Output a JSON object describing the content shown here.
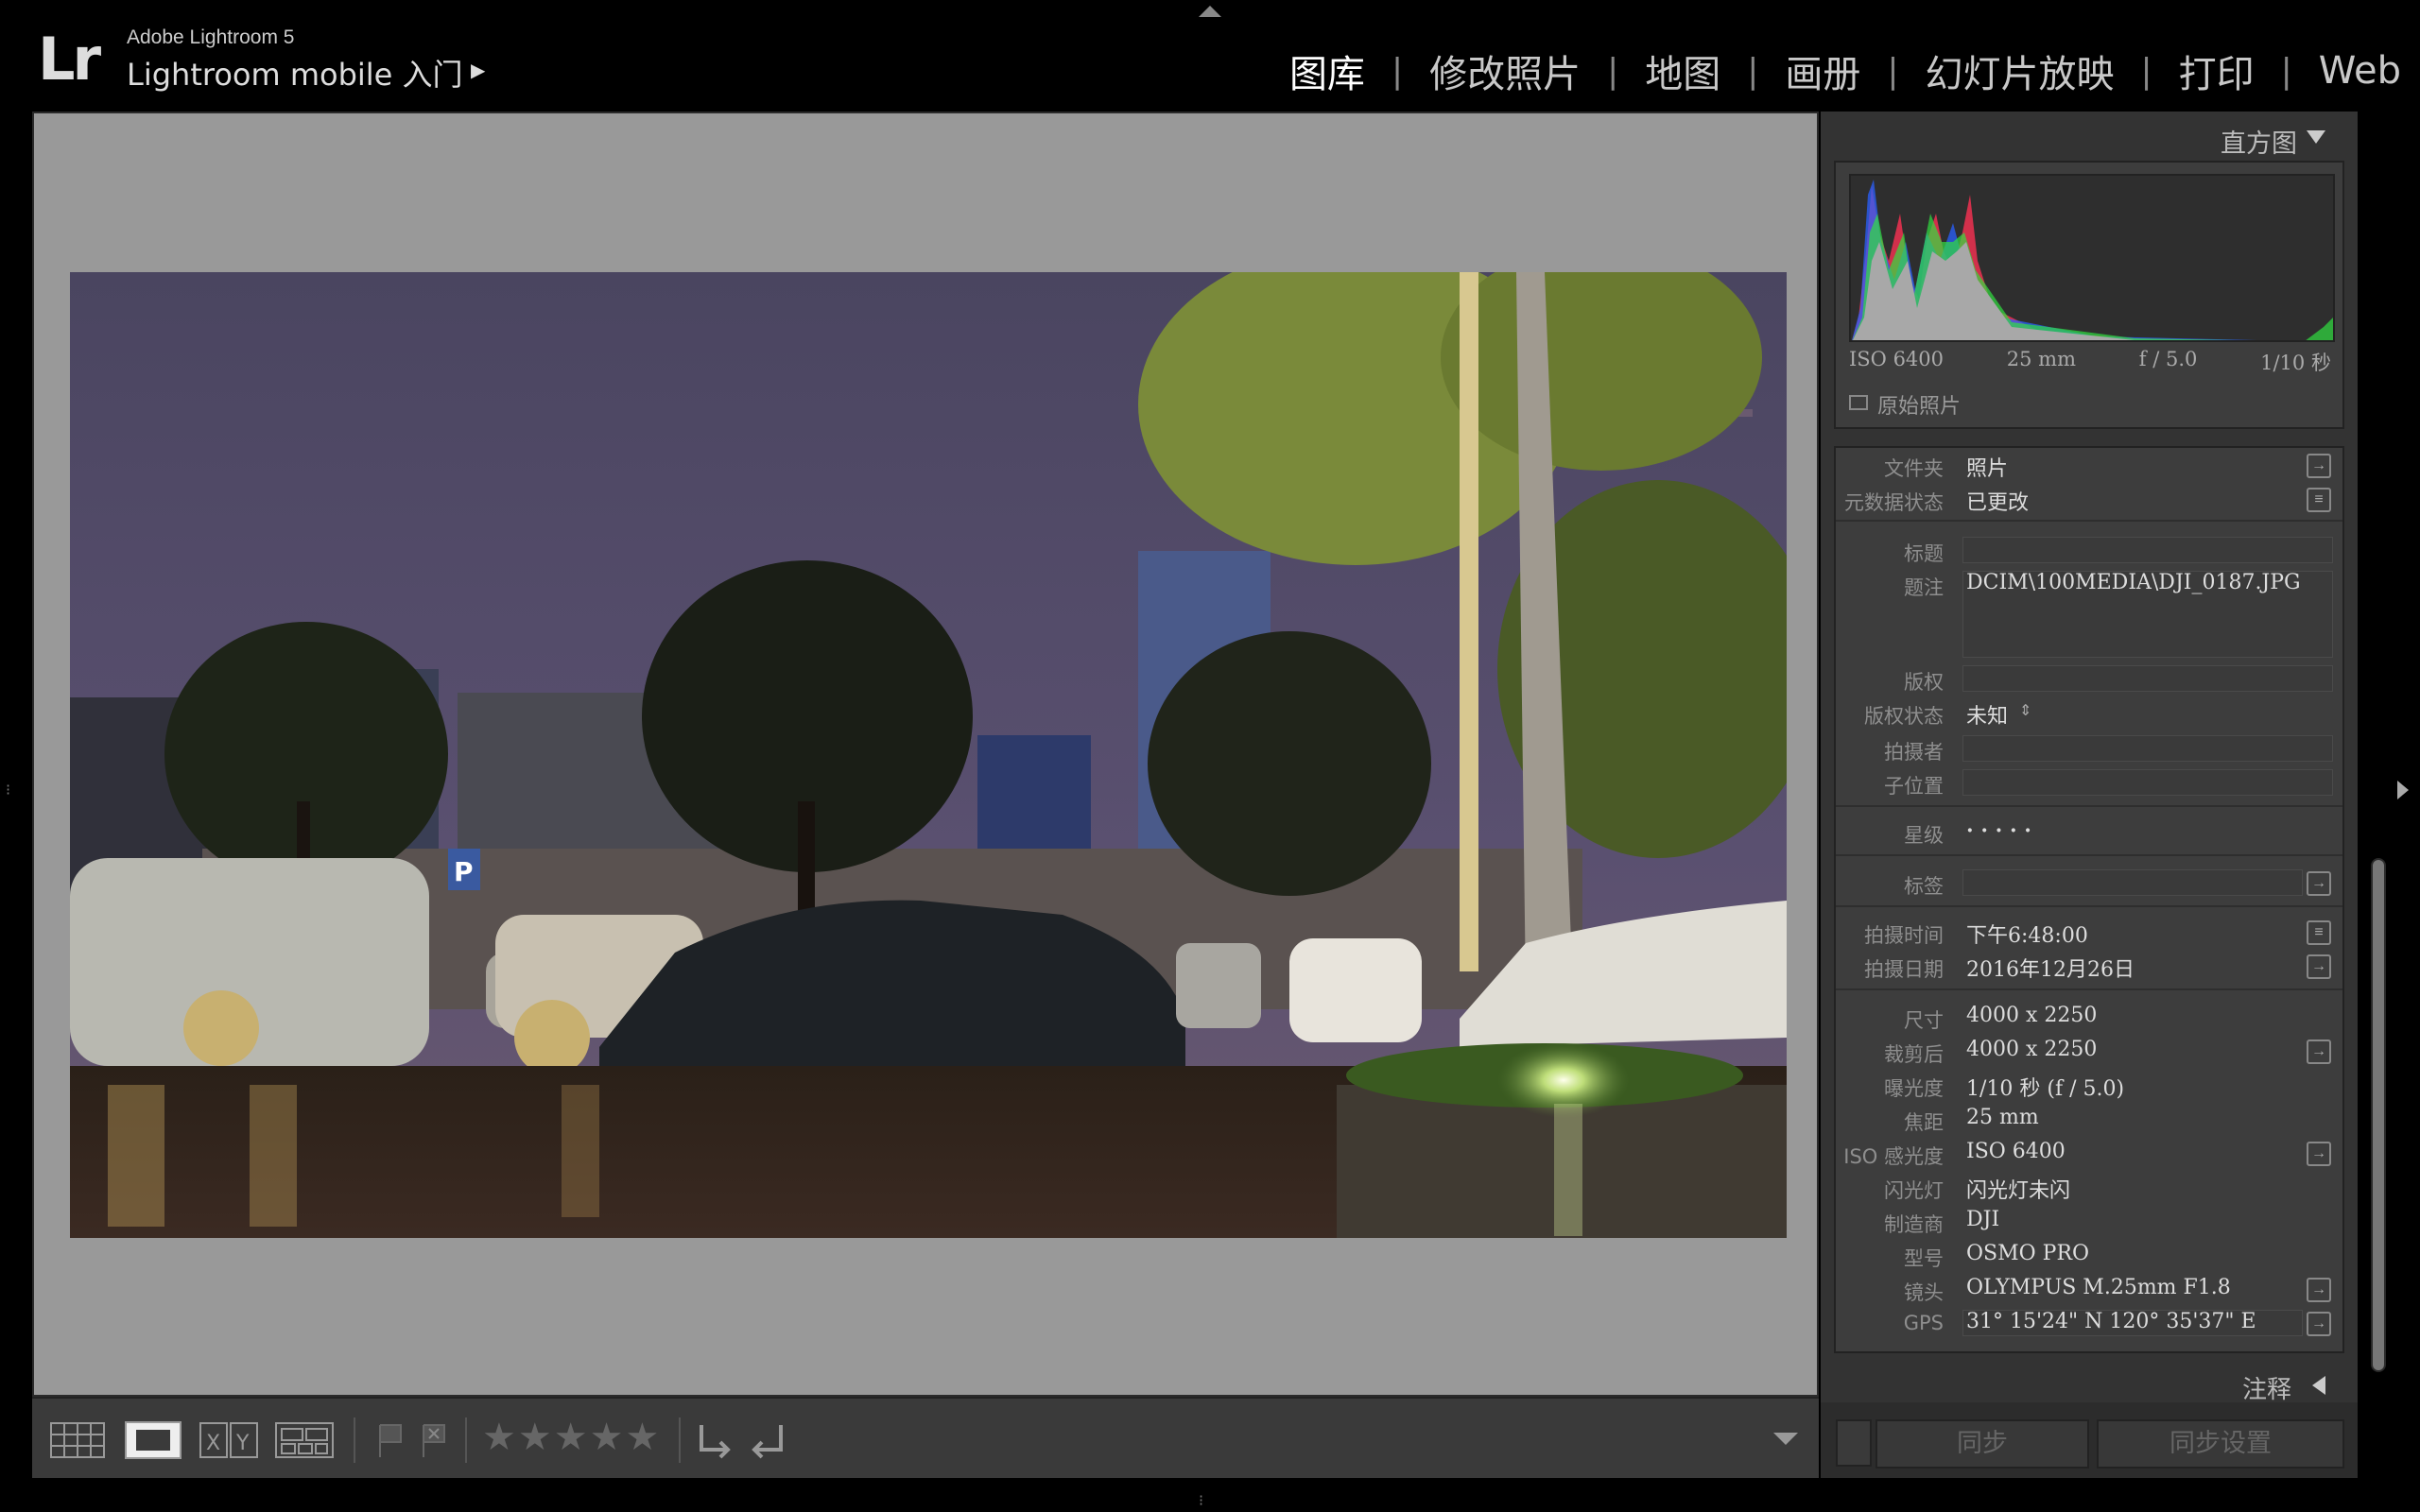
{
  "app": {
    "logo": "Lr",
    "name": "Adobe Lightroom 5",
    "catalog": "Lightroom mobile 入门",
    "catalog_arrow": "▶"
  },
  "modules": [
    {
      "label": "图库",
      "active": true
    },
    {
      "label": "修改照片",
      "active": false
    },
    {
      "label": "地图",
      "active": false
    },
    {
      "label": "画册",
      "active": false
    },
    {
      "label": "幻灯片放映",
      "active": false
    },
    {
      "label": "打印",
      "active": false
    },
    {
      "label": "Web",
      "active": false
    }
  ],
  "histogram": {
    "title": "直方图",
    "iso": "ISO 6400",
    "focal": "25 mm",
    "aperture": "f / 5.0",
    "shutter": "1/10 秒",
    "original_label": "原始照片"
  },
  "metadata": {
    "folder_label": "文件夹",
    "folder_value": "照片",
    "status_label": "元数据状态",
    "status_value": "已更改",
    "title_label": "标题",
    "caption_label": "题注",
    "caption_value": "DCIM\\100MEDIA\\DJI_0187.JPG",
    "copyright_label": "版权",
    "copyright_status_label": "版权状态",
    "copyright_status_value": "未知",
    "creator_label": "拍摄者",
    "sublocation_label": "子位置",
    "rating_label": "星级",
    "rating_value": "·  ·  ·  ·  ·",
    "label_label": "标签",
    "capture_time_label": "拍摄时间",
    "capture_time_value": "下午6:48:00",
    "capture_date_label": "拍摄日期",
    "capture_date_value": "2016年12月26日",
    "dimensions_label": "尺寸",
    "dimensions_value": "4000 x 2250",
    "cropped_label": "裁剪后",
    "cropped_value": "4000 x 2250",
    "exposure_label": "曝光度",
    "exposure_value": "1/10 秒 (f / 5.0)",
    "focal_label": "焦距",
    "focal_value": "25 mm",
    "iso_label": "ISO 感光度",
    "iso_value": "ISO 6400",
    "flash_label": "闪光灯",
    "flash_value": "闪光灯未闪",
    "make_label": "制造商",
    "make_value": "DJI",
    "model_label": "型号",
    "model_value": "OSMO PRO",
    "lens_label": "镜头",
    "lens_value": "OLYMPUS M.25mm F1.8",
    "gps_label": "GPS",
    "gps_value": "31° 15'24\" N 120° 35'37\" E"
  },
  "annotations": {
    "title": "注释"
  },
  "sync": {
    "sync_label": "同步",
    "sync_settings_label": "同步设置"
  },
  "toolbar": {
    "stars": "★★★★★"
  },
  "colors": {
    "background": "#000000",
    "center_bg": "#999999",
    "panel_bg": "#333333"
  }
}
